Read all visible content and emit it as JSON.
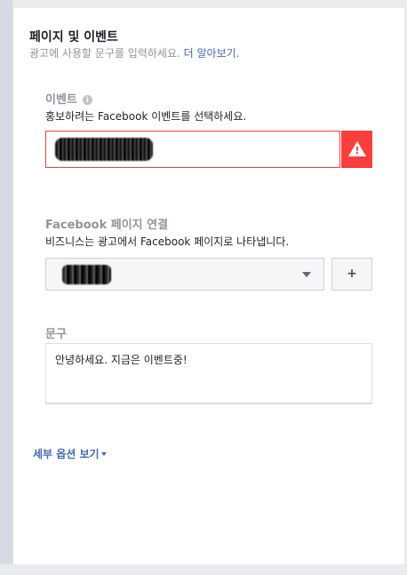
{
  "section": {
    "title": "페이지 및 이벤트",
    "subtitle": "광고에 사용할 문구를 입력하세요.",
    "learn_more": "더 알아보기."
  },
  "event": {
    "label": "이벤트",
    "info_icon": "info-icon",
    "description": "홍보하려는 Facebook 이벤트를 선택하세요.",
    "error_icon": "warning-triangle-icon",
    "error_color": "#fa3e3e",
    "error_glyph": "!"
  },
  "page_connect": {
    "label": "Facebook 페이지 연결",
    "description": "비즈니스는 광고에서 Facebook 페이지로 나타냅니다.",
    "add_label": "+"
  },
  "text": {
    "label": "문구",
    "value": "안녕하세요. 지금은 이벤트중!"
  },
  "more_options": {
    "label": "세부 옵션 보기"
  }
}
